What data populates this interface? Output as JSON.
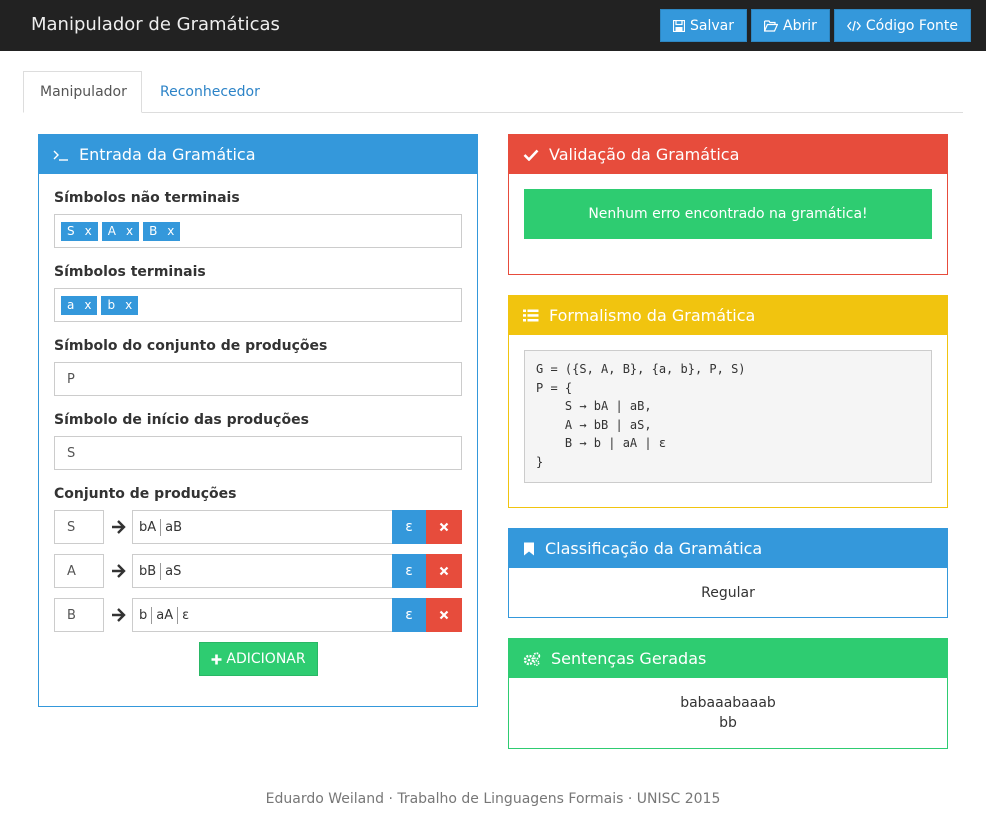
{
  "navbar": {
    "title": "Manipulador de Gramáticas",
    "buttons": [
      {
        "label": "Salvar",
        "icon": "save-icon"
      },
      {
        "label": "Abrir",
        "icon": "folder-open-icon"
      },
      {
        "label": "Código Fonte",
        "icon": "code-icon"
      }
    ]
  },
  "tabs": [
    {
      "label": "Manipulador",
      "active": true
    },
    {
      "label": "Reconhecedor",
      "active": false
    }
  ],
  "entrada": {
    "title": "Entrada da Gramática",
    "nonterminals_label": "Símbolos não terminais",
    "nonterminals": [
      "S",
      "A",
      "B"
    ],
    "terminals_label": "Símbolos terminais",
    "terminals": [
      "a",
      "b"
    ],
    "prodset_label": "Símbolo do conjunto de produções",
    "prodset_value": "P",
    "start_label": "Símbolo de início das produções",
    "start_value": "S",
    "productions_label": "Conjunto de produções",
    "productions": [
      {
        "var": "S",
        "rhs": [
          "bA",
          "aB"
        ]
      },
      {
        "var": "A",
        "rhs": [
          "bB",
          "aS"
        ]
      },
      {
        "var": "B",
        "rhs": [
          "b",
          "aA",
          "ε"
        ]
      }
    ],
    "epsilon_label": "ε",
    "add_label": "ADICIONAR",
    "tag_remove": "x"
  },
  "validacao": {
    "title": "Validação da Gramática",
    "message": "Nenhum erro encontrado na gramática!"
  },
  "formalismo": {
    "title": "Formalismo da Gramática",
    "text": "G = ({S, A, B}, {a, b}, P, S)\nP = {\n    S → bA | aB,\n    A → bB | aS,\n    B → b | aA | ε\n}"
  },
  "classificacao": {
    "title": "Classificação da Gramática",
    "value": "Regular"
  },
  "sentencas": {
    "title": "Sentenças Geradas",
    "items": [
      "babaaabaaab",
      "bb"
    ]
  },
  "footer": "Eduardo Weiland · Trabalho de Linguagens Formais · UNISC 2015",
  "colors": {
    "primary": "#3498db",
    "danger": "#e74c3c",
    "warning": "#f1c40f",
    "success": "#2ecc71",
    "navbar": "#222222"
  }
}
